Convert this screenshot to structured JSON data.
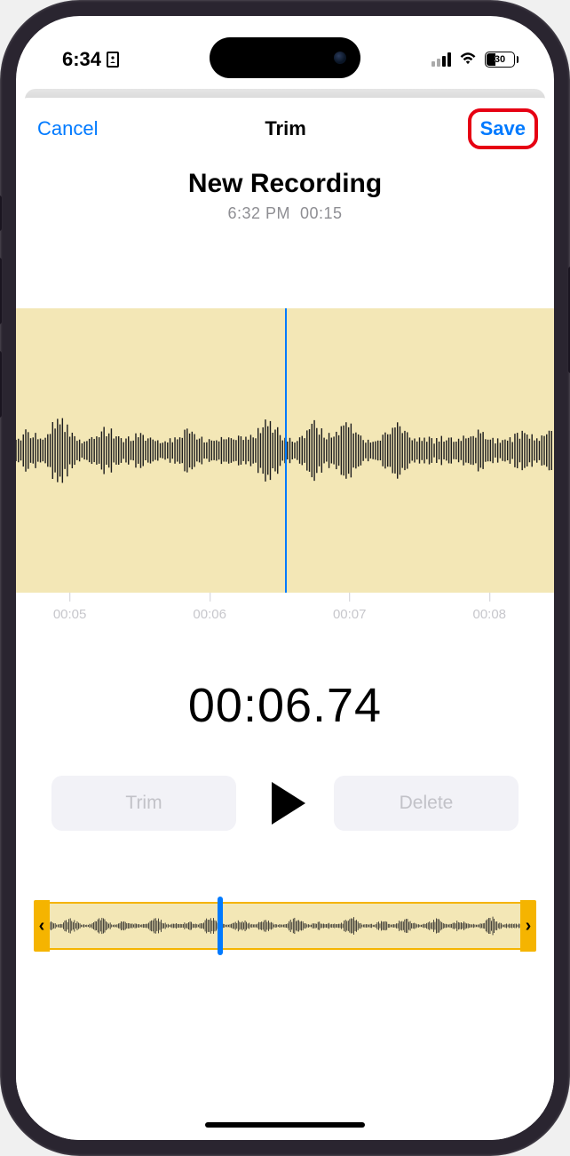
{
  "status": {
    "time": "6:34",
    "battery_text": "30"
  },
  "nav": {
    "cancel": "Cancel",
    "title": "Trim",
    "save": "Save"
  },
  "recording": {
    "title": "New Recording",
    "timestamp": "6:32 PM",
    "duration": "00:15"
  },
  "ruler": {
    "t0": "00:05",
    "t1": "00:06",
    "t2": "00:07",
    "t3": "00:08"
  },
  "playback": {
    "current_time": "00:06.74"
  },
  "controls": {
    "trim": "Trim",
    "delete": "Delete"
  },
  "trim_handles": {
    "left_glyph": "‹",
    "right_glyph": "›"
  },
  "colors": {
    "accent": "#007aff",
    "highlight_border": "#e60013",
    "selection_bg": "#f3e7b6",
    "trim_yellow": "#f5b400"
  }
}
